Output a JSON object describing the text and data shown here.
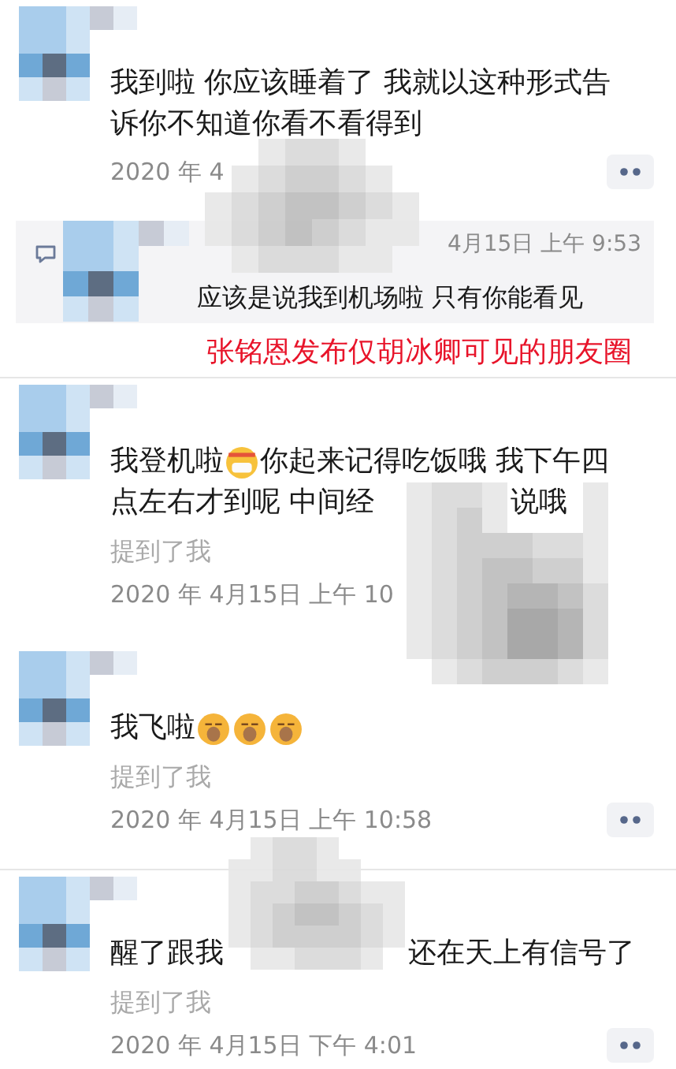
{
  "feed": [
    {
      "kind": "post",
      "lines": [
        [
          {
            "kind": "text",
            "text": "我到啦 你应该睡着了 我就以这种形式告"
          }
        ],
        [
          {
            "kind": "text",
            "text": "诉你不知道你看不看得到"
          }
        ]
      ],
      "time": "2020 年 4",
      "more_button": true,
      "comment": {
        "time": "4月15日 上午 9:53",
        "text": "应该是说我到机场啦 只有你能看见"
      }
    },
    {
      "kind": "caption",
      "text": "张铭恩发布仅胡冰卿可见的朋友圈"
    },
    {
      "kind": "post",
      "lines": [
        [
          {
            "kind": "text",
            "text": "我登机啦"
          },
          {
            "kind": "emoji_mask"
          },
          {
            "kind": "text",
            "text": "你起来记得吃饭哦 我下午四"
          }
        ],
        [
          {
            "kind": "text",
            "text": "点左右才到呢 中间经"
          },
          {
            "kind": "gap"
          },
          {
            "kind": "text",
            "text": "说哦"
          }
        ]
      ],
      "mention": "提到了我",
      "time": "2020 年 4月15日 上午 10",
      "more_button": false
    },
    {
      "kind": "post",
      "lines": [
        [
          {
            "kind": "text",
            "text": "我飞啦 "
          },
          {
            "kind": "emoji_sleep"
          },
          {
            "kind": "emoji_sleep"
          },
          {
            "kind": "emoji_sleep"
          }
        ]
      ],
      "mention": "提到了我",
      "time": "2020 年 4月15日 上午 10:58",
      "more_button": true
    },
    {
      "kind": "post",
      "lines": [
        [
          {
            "kind": "text",
            "text": "醒了跟我"
          },
          {
            "kind": "gap"
          },
          {
            "kind": "text",
            "text": "还在天上有信号了"
          }
        ]
      ],
      "mention": "提到了我",
      "time": "2020 年 4月15日 下午 4:01",
      "more_button": true
    }
  ]
}
